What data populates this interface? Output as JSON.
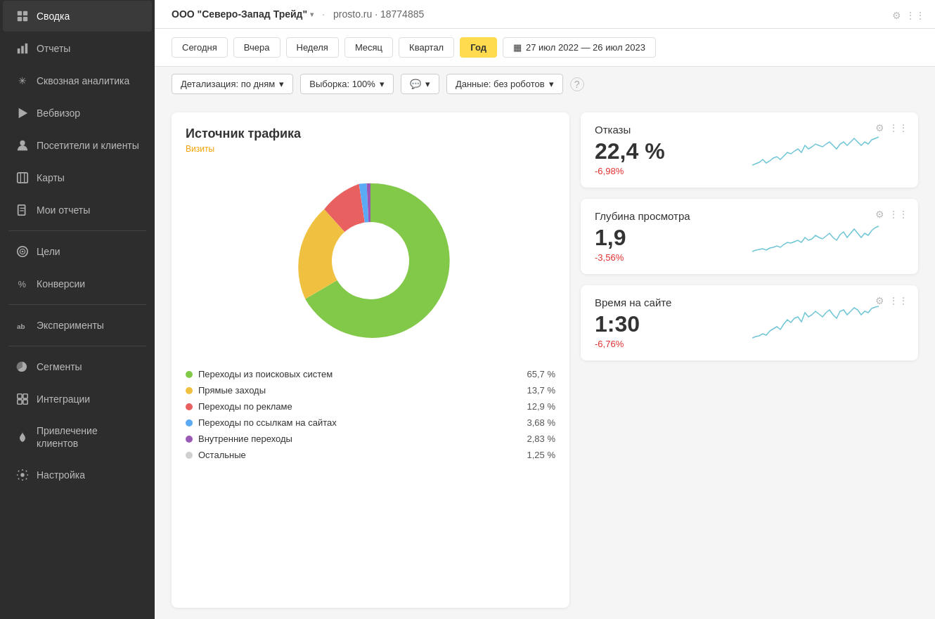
{
  "sidebar": {
    "items": [
      {
        "id": "svodka",
        "label": "Сводка",
        "active": true,
        "icon": "dashboard"
      },
      {
        "id": "otchety",
        "label": "Отчеты",
        "active": false,
        "icon": "bar-chart"
      },
      {
        "id": "skvoznaya",
        "label": "Сквозная аналитика",
        "active": false,
        "icon": "asterisk"
      },
      {
        "id": "webvisor",
        "label": "Вебвизор",
        "active": false,
        "icon": "play"
      },
      {
        "id": "posetiteli",
        "label": "Посетители и клиенты",
        "active": false,
        "icon": "user"
      },
      {
        "id": "karty",
        "label": "Карты",
        "active": false,
        "icon": "map"
      },
      {
        "id": "moi-otchety",
        "label": "Мои отчеты",
        "active": false,
        "icon": "file"
      },
      {
        "id": "tseli",
        "label": "Цели",
        "active": false,
        "icon": "target"
      },
      {
        "id": "konversii",
        "label": "Конверсии",
        "active": false,
        "icon": "percent"
      },
      {
        "id": "eksperimenty",
        "label": "Эксперименты",
        "active": false,
        "icon": "ab"
      },
      {
        "id": "segmenty",
        "label": "Сегменты",
        "active": false,
        "icon": "pie"
      },
      {
        "id": "integracii",
        "label": "Интеграции",
        "active": false,
        "icon": "puzzle"
      },
      {
        "id": "privlechenie",
        "label": "Привлечение клиентов",
        "active": false,
        "icon": "flame"
      },
      {
        "id": "nastroika",
        "label": "Настройка",
        "active": false,
        "icon": "gear"
      }
    ]
  },
  "header": {
    "company": "ООО \"Северо-Запад Трейд\"",
    "chevron": "▾",
    "separator": "·",
    "site": "prosto.ru · 18774885"
  },
  "periods": {
    "buttons": [
      {
        "id": "today",
        "label": "Сегодня",
        "active": false
      },
      {
        "id": "yesterday",
        "label": "Вчера",
        "active": false
      },
      {
        "id": "week",
        "label": "Неделя",
        "active": false
      },
      {
        "id": "month",
        "label": "Месяц",
        "active": false
      },
      {
        "id": "quarter",
        "label": "Квартал",
        "active": false
      },
      {
        "id": "year",
        "label": "Год",
        "active": true
      }
    ],
    "date_range": "27 июл 2022 — 26 июл 2023",
    "calendar_icon": "▦"
  },
  "filters": {
    "detail": "Детализация: по дням",
    "sample": "Выборка: 100%",
    "comments": "💬",
    "data": "Данные: без роботов",
    "help": "?"
  },
  "traffic_card": {
    "title": "Источник трафика",
    "subtitle": "Визиты",
    "legend": [
      {
        "label": "Переходы из поисковых систем",
        "pct": "65,7 %",
        "color": "#82c94a"
      },
      {
        "label": "Прямые заходы",
        "pct": "13,7 %",
        "color": "#f0c040"
      },
      {
        "label": "Переходы по рекламе",
        "pct": "12,9 %",
        "color": "#e86060"
      },
      {
        "label": "Переходы по ссылкам на сайтах",
        "pct": "3,68 %",
        "color": "#5baaf5"
      },
      {
        "label": "Внутренние переходы",
        "pct": "2,83 %",
        "color": "#9b59b6"
      },
      {
        "label": "Остальные",
        "pct": "1,25 %",
        "color": "#d0d0d0"
      }
    ]
  },
  "metrics": [
    {
      "id": "otkazы",
      "title": "Отказы",
      "value": "22,4 %",
      "change": "-6,98%",
      "change_type": "neg"
    },
    {
      "id": "glubina",
      "title": "Глубина просмотра",
      "value": "1,9",
      "change": "-3,56%",
      "change_type": "neg"
    },
    {
      "id": "vremya",
      "title": "Время на сайте",
      "value": "1:30",
      "change": "-6,76%",
      "change_type": "neg"
    }
  ]
}
